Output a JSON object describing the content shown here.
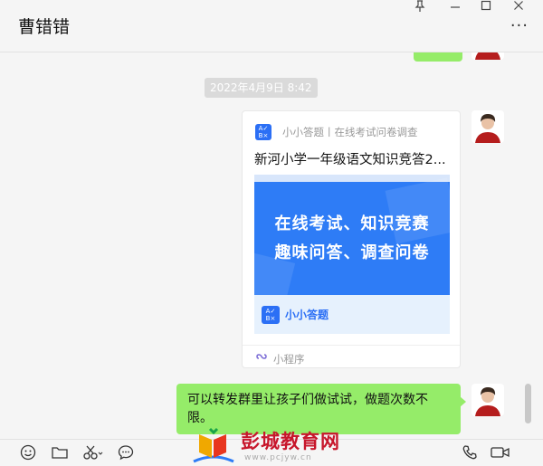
{
  "header": {
    "title": "曹错错",
    "pin_icon": "pin-icon",
    "minimize_icon": "minimize-icon",
    "maximize_icon": "maximize-icon",
    "close_icon": "close-icon",
    "more_icon": "more-icon"
  },
  "chat": {
    "timestamp": "2022年4月9日 8:42",
    "mini_program_card": {
      "source": "小小答题丨在线考试问卷调查",
      "title": "新河小学一年级语文知识竞答2...",
      "banner_line1": "在线考试、知识竞赛",
      "banner_line2": "趣味问答、调查问卷",
      "banner_logo_text": "A ✓ B ×",
      "banner_app_name": "小小答题",
      "footer_label": "小程序",
      "brand_color": "#2e7cf6"
    },
    "message": {
      "text": "可以转发群里让孩子们做试试，做题次数不限。",
      "bubble_color": "#95ec69"
    }
  },
  "toolbar": {
    "left_icons": [
      "emoji-icon",
      "folder-icon",
      "scissors-icon",
      "comment-icon"
    ],
    "right_icons": [
      "phone-icon",
      "video-icon"
    ]
  },
  "watermark": {
    "text": "彭城教育网",
    "sub": "www.pcjyw.cn"
  }
}
